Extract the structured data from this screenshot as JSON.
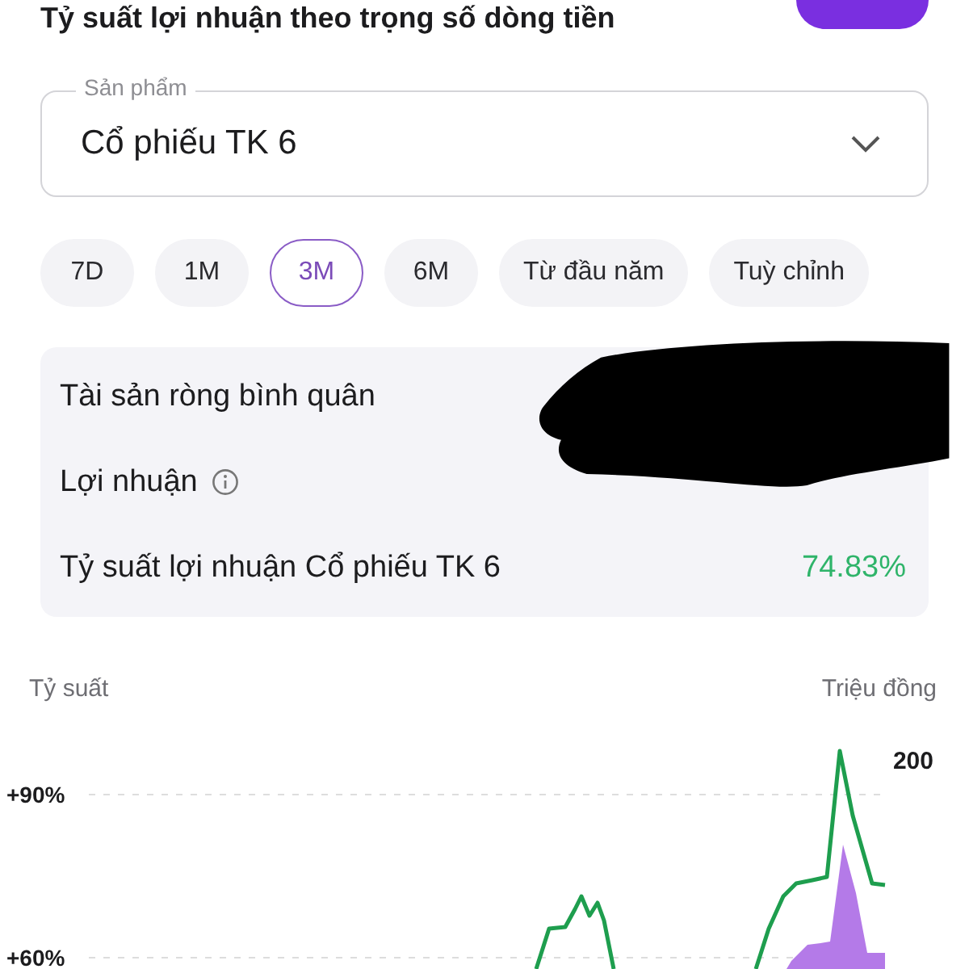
{
  "header": {
    "title": "Tỷ suất lợi nhuận theo trọng số dòng tiền"
  },
  "product_select": {
    "label": "Sản phẩm",
    "value": "Cổ phiếu TK 6"
  },
  "periods": [
    {
      "label": "7D",
      "selected": false
    },
    {
      "label": "1M",
      "selected": false
    },
    {
      "label": "3M",
      "selected": true
    },
    {
      "label": "6M",
      "selected": false
    },
    {
      "label": "Từ đầu năm",
      "selected": false
    },
    {
      "label": "Tuỳ chỉnh",
      "selected": false
    }
  ],
  "summary": [
    {
      "label": "Tài sản ròng bình quân"
    },
    {
      "label": "Lợi nhuận",
      "info": true
    },
    {
      "label": "Tỷ suất lợi nhuận Cổ phiếu TK 6",
      "value": "74.83%"
    }
  ],
  "chart": {
    "left_axis_title": "Tỷ suất",
    "right_axis_title": "Triệu đồng",
    "left_ticks": [
      "+90%",
      "+60%"
    ],
    "right_axis_tick": "200"
  }
}
